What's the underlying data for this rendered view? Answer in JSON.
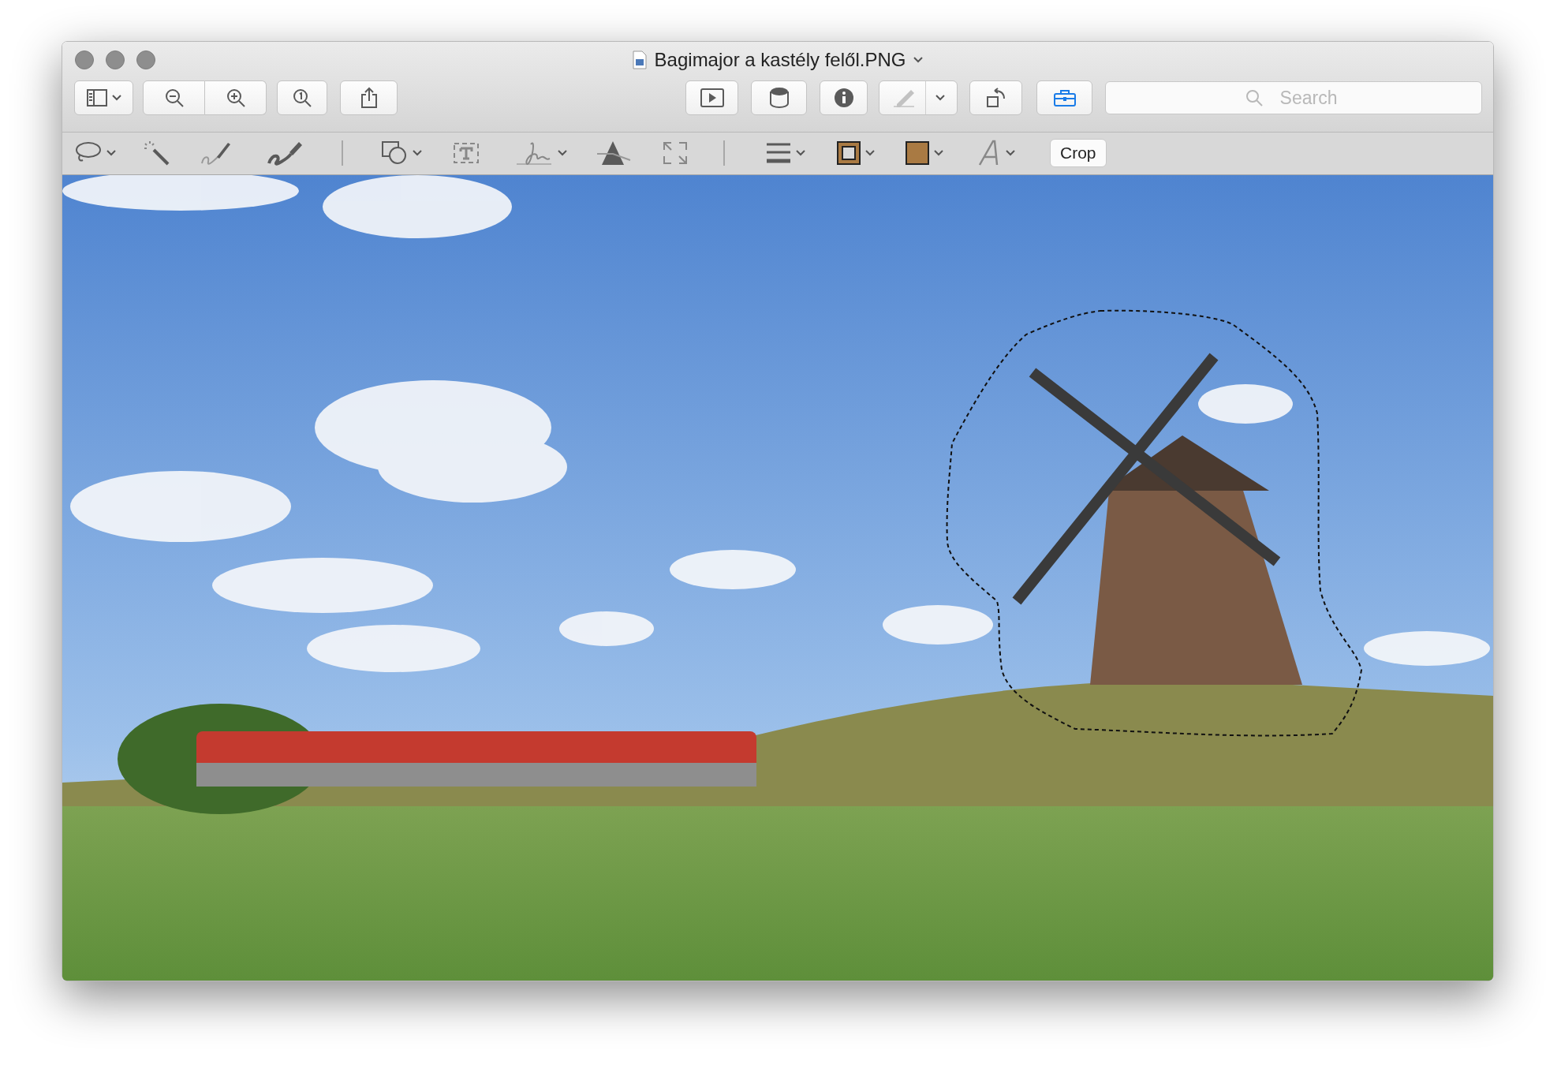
{
  "window": {
    "title": "Bagimajor a kastély felől.PNG"
  },
  "toolbar": {
    "annotate_disabled": true,
    "markup_toolbar_shown": true,
    "search": {
      "placeholder": "Search"
    }
  },
  "markup_bar": {
    "color_wells": [
      {
        "kind": "border",
        "color": "#a97a43"
      },
      {
        "kind": "fill",
        "color": "#a97a43"
      }
    ],
    "crop_button": "Crop"
  },
  "image": {
    "selection_shown": true
  }
}
